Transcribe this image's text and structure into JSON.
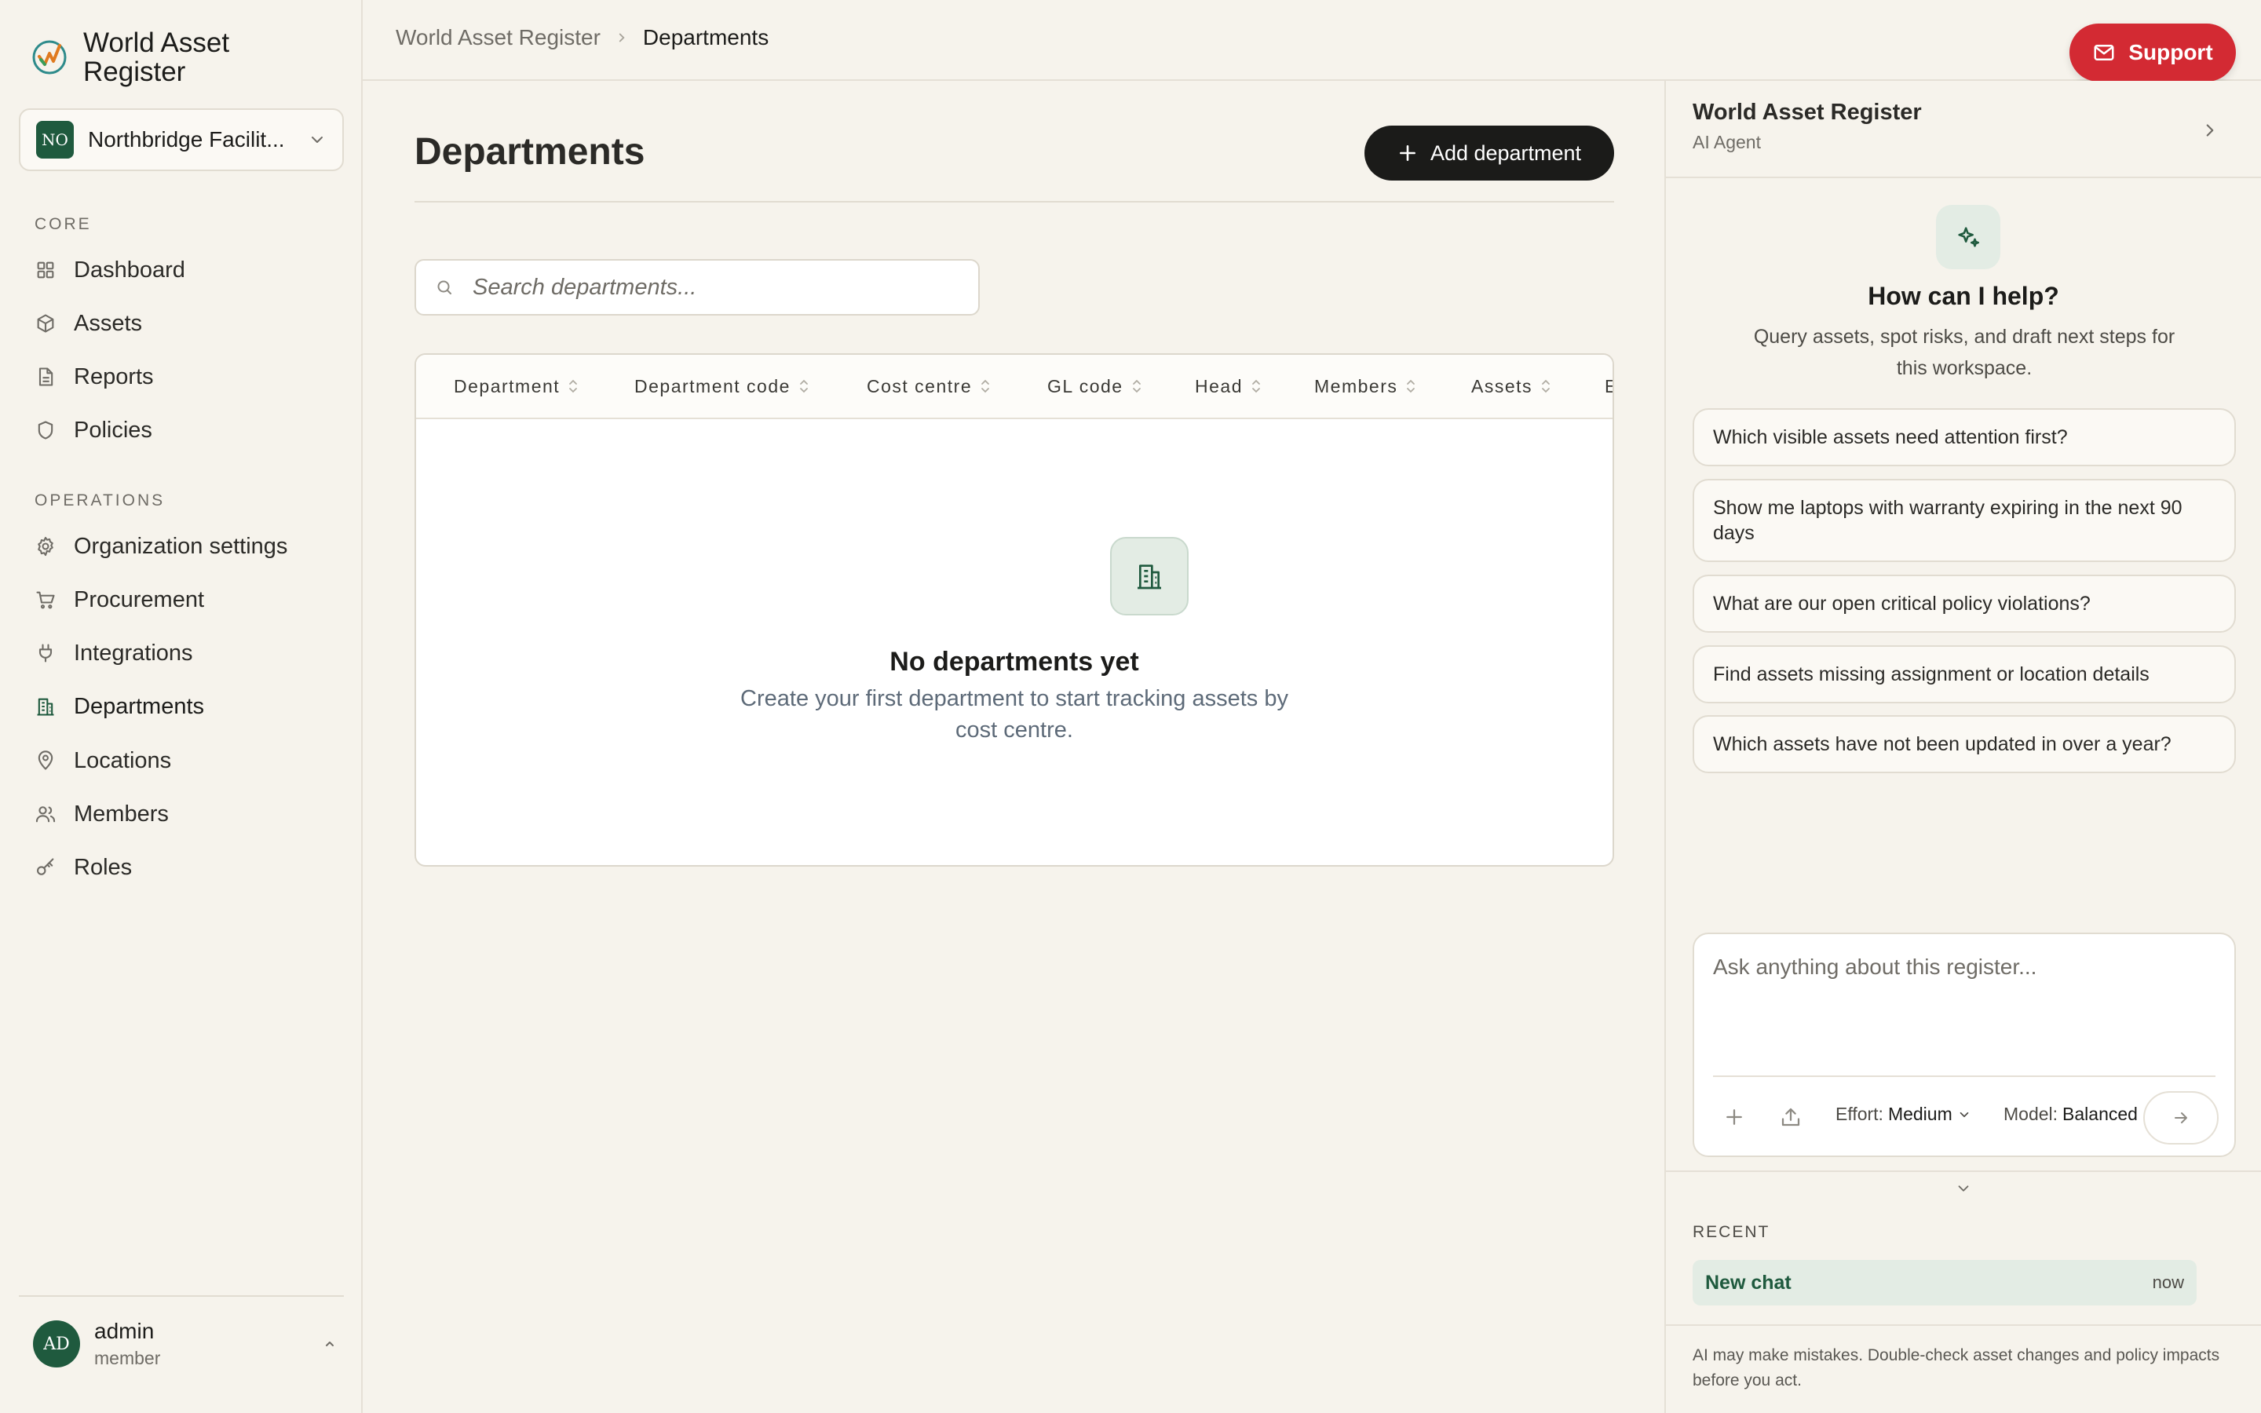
{
  "app": {
    "name": "World Asset Register"
  },
  "org_switcher": {
    "badge": "NO",
    "name": "Northbridge Facilit..."
  },
  "sidebar": {
    "sections": [
      {
        "label": "CORE",
        "items": [
          {
            "label": "Dashboard",
            "icon": "dashboard-icon"
          },
          {
            "label": "Assets",
            "icon": "box-icon"
          },
          {
            "label": "Reports",
            "icon": "document-icon"
          },
          {
            "label": "Policies",
            "icon": "shield-icon"
          }
        ]
      },
      {
        "label": "OPERATIONS",
        "items": [
          {
            "label": "Organization settings",
            "icon": "gear-icon"
          },
          {
            "label": "Procurement",
            "icon": "cart-icon"
          },
          {
            "label": "Integrations",
            "icon": "plug-icon"
          },
          {
            "label": "Departments",
            "icon": "building-icon",
            "active": true
          },
          {
            "label": "Locations",
            "icon": "map-pin-icon"
          },
          {
            "label": "Members",
            "icon": "users-icon"
          },
          {
            "label": "Roles",
            "icon": "key-icon"
          }
        ]
      }
    ]
  },
  "user": {
    "initials": "AD",
    "name": "admin",
    "role": "member"
  },
  "breadcrumb": [
    "World Asset Register",
    "Departments"
  ],
  "support_label": "Support",
  "page": {
    "title": "Departments",
    "add_button_label": "Add department"
  },
  "search": {
    "placeholder": "Search departments...",
    "value": ""
  },
  "table": {
    "columns": [
      "Department",
      "Department code",
      "Cost centre",
      "GL code",
      "Head",
      "Members",
      "Assets",
      "E"
    ],
    "rows": []
  },
  "empty_state": {
    "title": "No departments yet",
    "description": "Create your first department to start tracking assets by cost centre."
  },
  "ai_panel": {
    "title": "World Asset Register",
    "subtitle": "AI Agent",
    "help_title": "How can I help?",
    "help_description": "Query assets, spot risks, and draft next steps for this workspace.",
    "suggestions": [
      "Which visible assets need attention first?",
      "Show me laptops with warranty expiring in the next 90 days",
      "What are our open critical policy violations?",
      "Find assets missing assignment or location details",
      "Which assets have not been updated in over a year?"
    ],
    "composer": {
      "placeholder": "Ask anything about this register...",
      "effort_label": "Effort:",
      "effort_value": "Medium",
      "model_label": "Model:",
      "model_value": "Balanced"
    },
    "recent": {
      "label": "RECENT",
      "items": [
        {
          "title": "New chat",
          "time": "now"
        }
      ]
    },
    "disclaimer": "AI may make mistakes. Double-check asset changes and policy impacts before you act."
  },
  "colors": {
    "brand_green": "#1f5a3e",
    "support_red": "#d32a33",
    "background": "#f6f3ec",
    "primary_button": "#1b1b19"
  }
}
